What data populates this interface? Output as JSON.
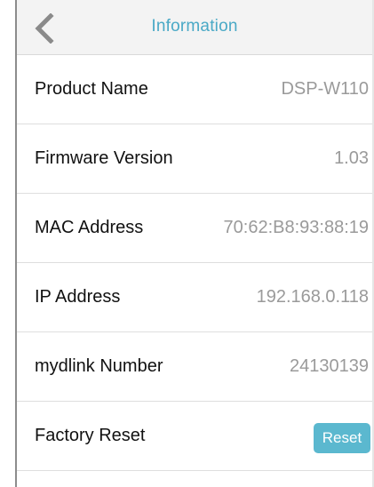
{
  "header": {
    "title": "Information",
    "back_icon": "chevron-left-icon"
  },
  "rows": [
    {
      "label": "Product Name",
      "value": "DSP-W110"
    },
    {
      "label": "Firmware Version",
      "value": "1.03"
    },
    {
      "label": "MAC Address",
      "value": "70:62:B8:93:88:19"
    },
    {
      "label": "IP Address",
      "value": "192.168.0.118"
    },
    {
      "label": "mydlink Number",
      "value": "24130139"
    },
    {
      "label": "Factory Reset",
      "button": "Reset"
    }
  ],
  "colors": {
    "accent": "#4aa9c6",
    "button": "#5bb8cf",
    "value_text": "#9a9a9a"
  }
}
